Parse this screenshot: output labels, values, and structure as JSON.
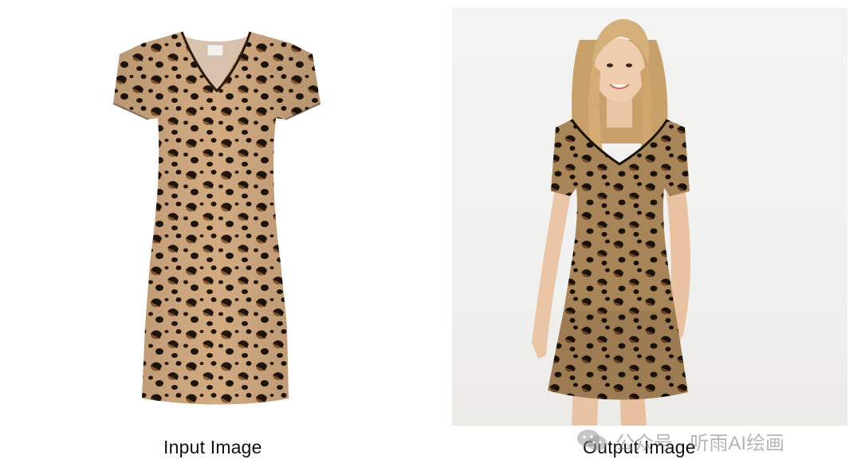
{
  "panels": {
    "input": {
      "caption": "Input Image",
      "subject": "leopard print v-neck short-sleeve dress, flat product shot"
    },
    "output": {
      "caption": "Output Image",
      "subject": "model wearing leopard print v-neck dress"
    }
  },
  "watermark": {
    "text": "公众号 · 听雨AI绘画",
    "icon": "wechat-icon"
  },
  "colors": {
    "page_background": "#ffffff",
    "photo_background": "#f2f2f0",
    "leopard_base": "#c9a17a",
    "leopard_spot": "#1f140e",
    "leopard_fill": "#8a5a2e",
    "caption_text": "#111111",
    "watermark_text": "#8a8a8a"
  }
}
